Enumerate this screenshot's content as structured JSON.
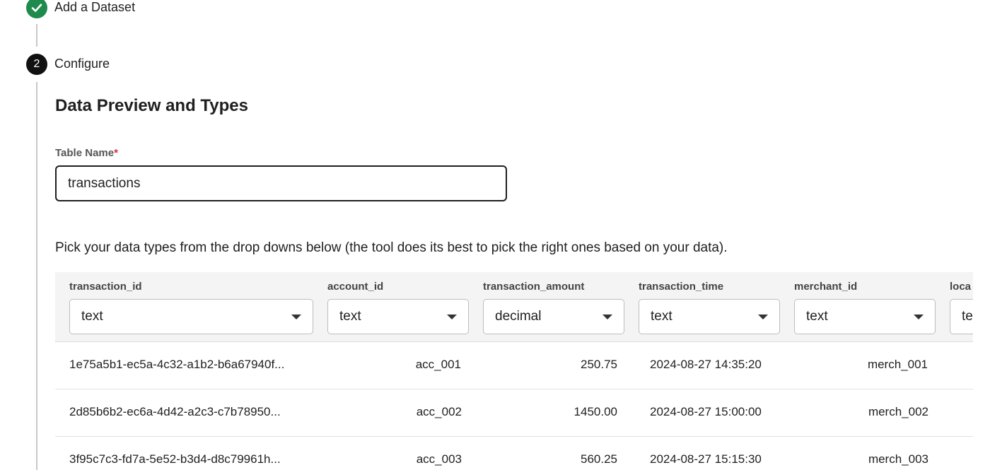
{
  "stepper": {
    "steps": [
      {
        "number": "",
        "label": "Add a Dataset",
        "state": "complete"
      },
      {
        "number": "2",
        "label": "Configure",
        "state": "active"
      }
    ]
  },
  "section": {
    "title": "Data Preview and Types"
  },
  "table_name": {
    "label": "Table Name",
    "required_marker": "*",
    "value": "transactions"
  },
  "hint": "Pick your data types from the drop downs below (the tool does its best to pick the right ones based on your data).",
  "preview": {
    "columns": [
      {
        "name": "transaction_id",
        "type": "text"
      },
      {
        "name": "account_id",
        "type": "text"
      },
      {
        "name": "transaction_amount",
        "type": "decimal"
      },
      {
        "name": "transaction_time",
        "type": "text"
      },
      {
        "name": "merchant_id",
        "type": "text"
      },
      {
        "name": "loca",
        "type": "te"
      }
    ],
    "rows": [
      [
        "1e75a5b1-ec5a-4c32-a1b2-b6a67940f...",
        "acc_001",
        "250.75",
        "2024-08-27 14:35:20",
        "merch_001"
      ],
      [
        "2d85b6b2-ec6a-4d42-a2c3-c7b78950...",
        "acc_002",
        "1450.00",
        "2024-08-27 15:00:00",
        "merch_002"
      ],
      [
        "3f95c7c3-fd7a-5e52-b3d4-d8c79961h...",
        "acc_003",
        "560.25",
        "2024-08-27 15:15:30",
        "merch_003"
      ]
    ]
  },
  "colors": {
    "complete": "#1e8a4c",
    "active": "#111111",
    "required": "#d32f2f",
    "header_bg": "#f4f4f4"
  },
  "icons": {
    "complete_step": "check-icon",
    "dropdown": "caret-down-icon"
  }
}
